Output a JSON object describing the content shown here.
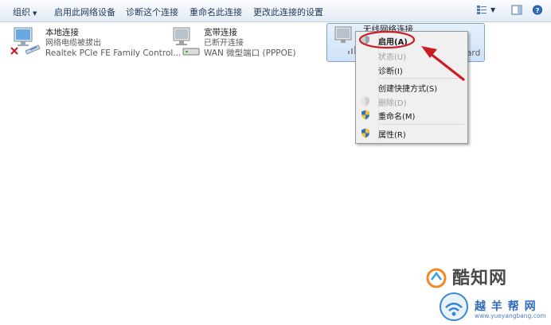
{
  "toolbar": {
    "organize": "组织",
    "enable_device": "启用此网络设备",
    "diagnose": "诊断这个连接",
    "rename": "重命名此连接",
    "change_settings": "更改此连接的设置"
  },
  "connections": [
    {
      "title": "本地连接",
      "status": "网络电缆被拔出",
      "device": "Realtek PCIe FE Family Control..."
    },
    {
      "title": "宽带连接",
      "status": "已断开连接",
      "device": "WAN 微型端口 (PPPOE)"
    },
    {
      "title": "无线网络连接",
      "status": "",
      "device": "ard"
    }
  ],
  "context_menu": {
    "items": [
      {
        "label": "启用(A)"
      },
      {
        "label": "状态(U)"
      },
      {
        "label": "诊断(I)"
      },
      {
        "label": "创建快捷方式(S)"
      },
      {
        "label": "删除(D)"
      },
      {
        "label": "重命名(M)"
      },
      {
        "label": "属性(R)"
      }
    ]
  },
  "watermark": {
    "brand1": "酷知网",
    "brand2": "越 羊 帮 网",
    "url": "www.yueyangbang.com"
  },
  "colors": {
    "accent_red": "#cc1c24",
    "selection_border": "#7da2ce",
    "watermark_blue": "#2d6bbf"
  }
}
